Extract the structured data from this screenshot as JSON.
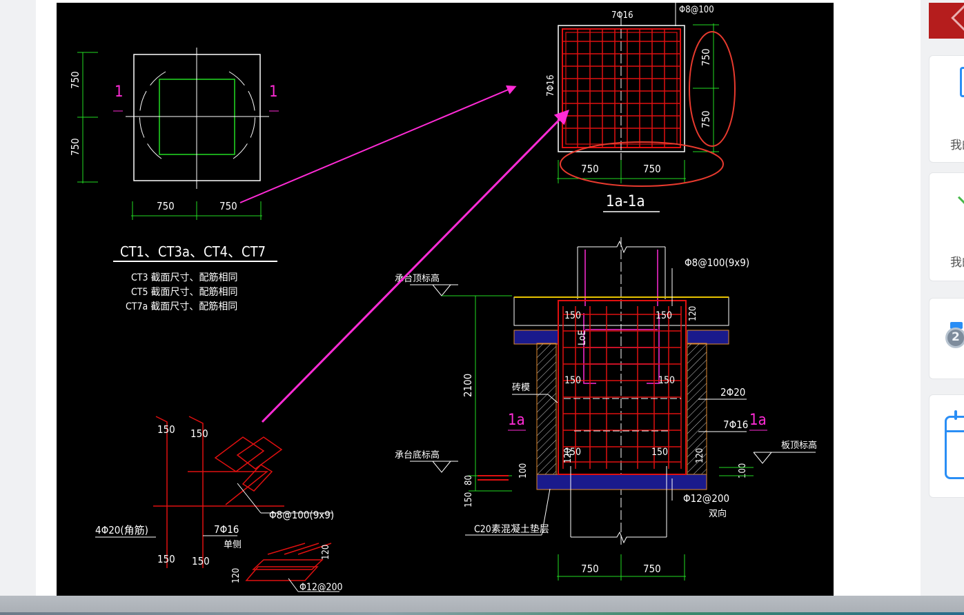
{
  "drawing": {
    "plan": {
      "dims_vertical": [
        "750",
        "750"
      ],
      "dims_horizontal": [
        "750",
        "750"
      ],
      "section_mark": "1",
      "title": "CT1、CT3a、CT4、CT7",
      "notes": [
        "CT3 截面尺寸、配筋相同",
        "CT5 截面尺寸、配筋相同",
        "CT7a 截面尺寸、配筋相同"
      ]
    },
    "section_top": {
      "label_top": "7Φ16",
      "label_stirrup": "Φ8@100",
      "label_left": "7Φ16",
      "dims_right": [
        "750",
        "750"
      ],
      "dims_bottom": [
        "750",
        "750"
      ],
      "title": "1a-1a"
    },
    "elevation": {
      "stirrup": "Φ8@100(9x9)",
      "cap_top_level": "承台顶标高",
      "cap_bottom_level": "承台底标高",
      "slab_top_level": "板顶标高",
      "depth": "2100",
      "dims": [
        "150",
        "150",
        "150",
        "150",
        "150",
        "150",
        "120",
        "120",
        "120",
        "100",
        "100",
        "80",
        "150"
      ],
      "loe": "LoE",
      "brick_label": "砖模",
      "bar_2": "2Φ20",
      "bar_7": "7Φ16",
      "mesh": "Φ12@200",
      "mesh_dir": "双向",
      "cushion": "C20素混凝土垫层",
      "section_marks": [
        "1a",
        "1a"
      ],
      "dims_bottom": [
        "750",
        "750"
      ]
    },
    "detail": {
      "dims": [
        "150",
        "150",
        "150",
        "150",
        "120",
        "120"
      ],
      "stirrup": "Φ8@100(9x9)",
      "corner_bars": "4Φ20(角筋)",
      "side_bars": "7Φ16",
      "side_bars_note": "单侧",
      "mesh": "Φ12@200"
    }
  },
  "sidebar": {
    "card_labels": [
      "我的",
      "我的"
    ]
  },
  "colors": {
    "background": "#000000",
    "dimension": "#22dd22",
    "rebar": "#e01010",
    "annotation": "#ff2bd6",
    "highlight": "#e83a2e",
    "outline": "#ffffff"
  }
}
